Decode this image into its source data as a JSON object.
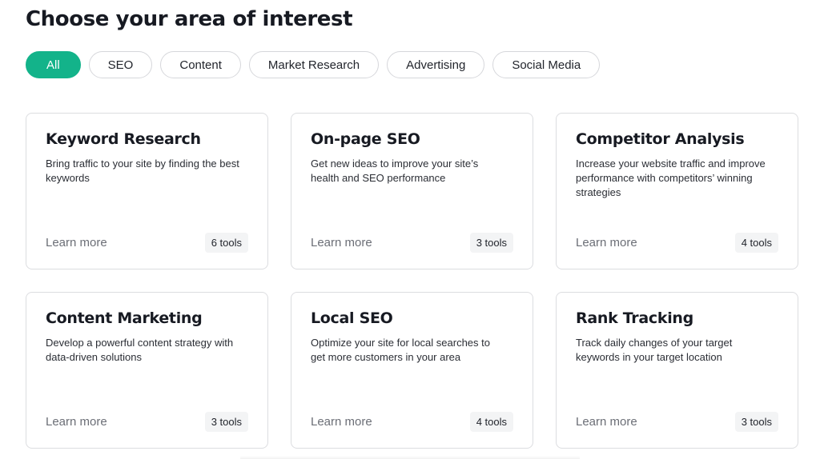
{
  "header": {
    "title": "Choose your area of interest"
  },
  "filters": [
    {
      "label": "All",
      "active": true
    },
    {
      "label": "SEO",
      "active": false
    },
    {
      "label": "Content",
      "active": false
    },
    {
      "label": "Market Research",
      "active": false
    },
    {
      "label": "Advertising",
      "active": false
    },
    {
      "label": "Social Media",
      "active": false
    }
  ],
  "colors": {
    "accent": "#13b38a",
    "card_border": "#dcdde0",
    "badge_bg": "#f3f4f5"
  },
  "cards": [
    {
      "title": "Keyword Research",
      "description": "Bring traffic to your site by finding the best keywords",
      "link": "Learn more",
      "tools": "6 tools"
    },
    {
      "title": "On-page SEO",
      "description": "Get new ideas to improve your site’s health and SEO performance",
      "link": "Learn more",
      "tools": "3 tools"
    },
    {
      "title": "Competitor Analysis",
      "description": "Increase your website traffic and improve performance with competitors’ winning strategies",
      "link": "Learn more",
      "tools": "4 tools"
    },
    {
      "title": "Content Marketing",
      "description": "Develop a powerful content strategy with data-driven solutions",
      "link": "Learn more",
      "tools": "3 tools"
    },
    {
      "title": "Local SEO",
      "description": "Optimize your site for local searches to get more customers in your area",
      "link": "Learn more",
      "tools": "4 tools"
    },
    {
      "title": "Rank Tracking",
      "description": "Track daily changes of your target keywords in your target location",
      "link": "Learn more",
      "tools": "3 tools"
    }
  ]
}
